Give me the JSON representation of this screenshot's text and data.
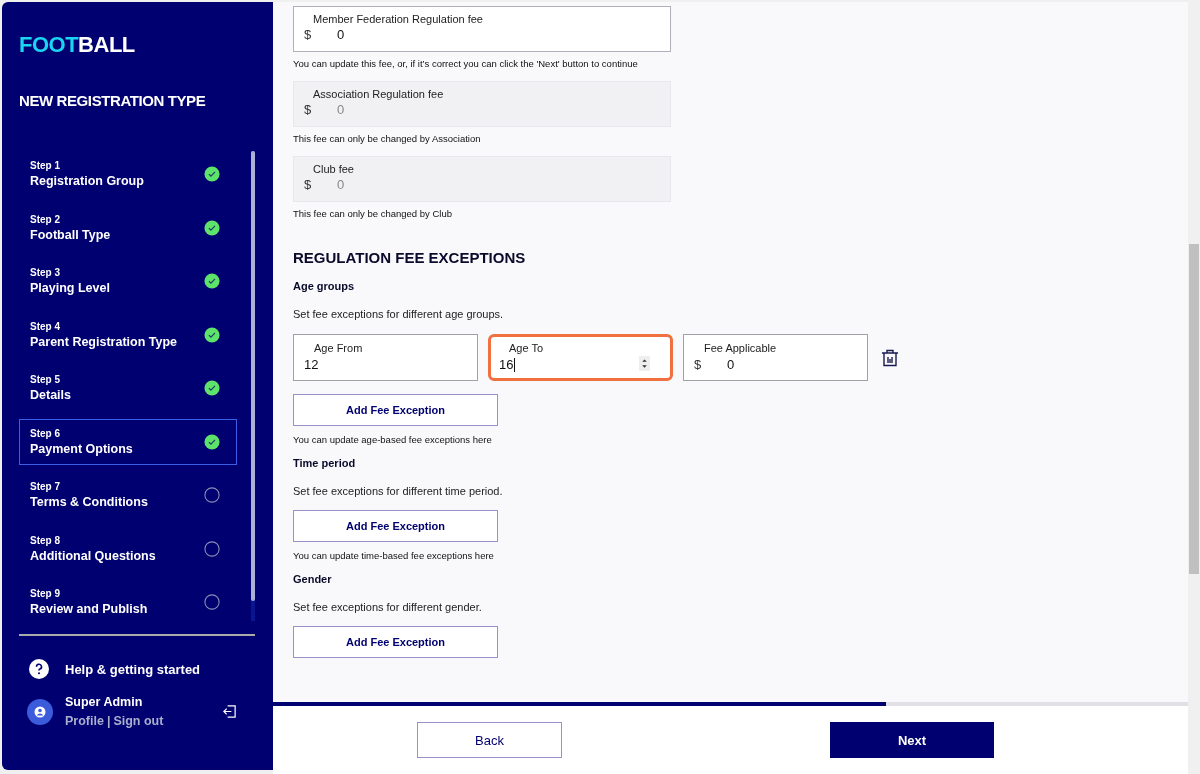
{
  "logo": {
    "first": "FOOT",
    "second": "BALL"
  },
  "sidebar": {
    "title": "NEW REGISTRATION TYPE",
    "steps": [
      {
        "step": "Step 1",
        "label": "Registration Group",
        "done": true,
        "selected": false
      },
      {
        "step": "Step 2",
        "label": "Football Type",
        "done": true,
        "selected": false
      },
      {
        "step": "Step 3",
        "label": "Playing Level",
        "done": true,
        "selected": false
      },
      {
        "step": "Step 4",
        "label": "Parent Registration Type",
        "done": true,
        "selected": false
      },
      {
        "step": "Step 5",
        "label": "Details",
        "done": true,
        "selected": false
      },
      {
        "step": "Step 6",
        "label": "Payment Options",
        "done": true,
        "selected": true
      },
      {
        "step": "Step 7",
        "label": "Terms & Conditions",
        "done": false,
        "selected": false
      },
      {
        "step": "Step 8",
        "label": "Additional Questions",
        "done": false,
        "selected": false
      },
      {
        "step": "Step 9",
        "label": "Review and Publish",
        "done": false,
        "selected": false
      }
    ],
    "help": "Help & getting started",
    "user": {
      "name": "Super Admin",
      "profile": "Profile",
      "separator": "|",
      "signout": "Sign out"
    }
  },
  "fees": [
    {
      "label": "Member Federation Regulation fee",
      "currency": "$",
      "value": "0",
      "disabled": false,
      "note": "You can update this fee, or, if it’s correct you can click the 'Next' button to continue"
    },
    {
      "label": "Association Regulation fee",
      "currency": "$",
      "value": "0",
      "disabled": true,
      "note": "This fee can only be changed by Association"
    },
    {
      "label": "Club fee",
      "currency": "$",
      "value": "0",
      "disabled": true,
      "note": "This fee can only be changed by Club"
    }
  ],
  "exceptions": {
    "title": "REGULATION FEE EXCEPTIONS",
    "groups": [
      {
        "title": "Age groups",
        "description": "Set fee exceptions for different age groups.",
        "fields": [
          {
            "kind": "number",
            "label": "Age From",
            "value": "12",
            "focused": false
          },
          {
            "kind": "number",
            "label": "Age To",
            "value": "16",
            "focused": true
          },
          {
            "kind": "currency",
            "label": "Fee Applicable",
            "currency": "$",
            "value": "0",
            "focused": false
          }
        ],
        "button": "Add Fee Exception",
        "note": "You can update age-based fee exceptions here"
      },
      {
        "title": "Time period",
        "description": "Set fee exceptions for different time period.",
        "button": "Add Fee Exception",
        "note": "You can update time-based fee exceptions here"
      },
      {
        "title": "Gender",
        "description": "Set fee exceptions for different gender.",
        "button": "Add Fee Exception"
      }
    ]
  },
  "progress": {
    "level": 0.67
  },
  "footer": {
    "back": "Back",
    "next": "Next"
  }
}
